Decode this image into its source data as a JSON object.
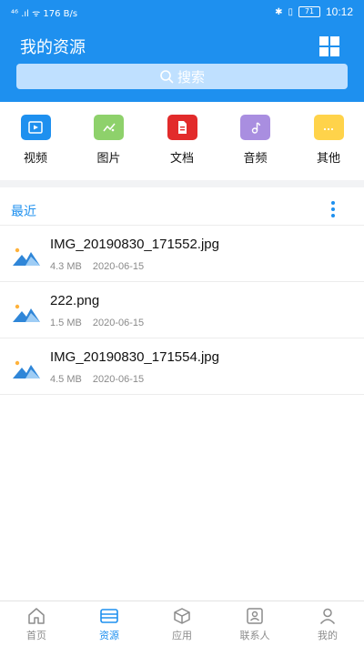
{
  "status_bar": {
    "left_text": "⁴⁶ .ıl ᯤ 176 B/s",
    "battery": "71",
    "time": "10:12"
  },
  "header": {
    "title": "我的资源",
    "search_label": "搜索"
  },
  "categories": [
    {
      "label": "视频",
      "icon": "video-icon",
      "color": "#1e90ef"
    },
    {
      "label": "图片",
      "icon": "image-icon",
      "color": "#8ed16b"
    },
    {
      "label": "文档",
      "icon": "document-icon",
      "color": "#e22b2b"
    },
    {
      "label": "音频",
      "icon": "audio-icon",
      "color": "#a98ee0"
    },
    {
      "label": "其他",
      "icon": "other-icon",
      "color": "#ffd34a"
    }
  ],
  "recent": {
    "title": "最近",
    "files": [
      {
        "name": "IMG_20190830_171552.jpg",
        "size": "4.3 MB",
        "date": "2020-06-15"
      },
      {
        "name": "222.png",
        "size": "1.5 MB",
        "date": "2020-06-15"
      },
      {
        "name": "IMG_20190830_171554.jpg",
        "size": "4.5 MB",
        "date": "2020-06-15"
      }
    ]
  },
  "bottom_nav": [
    {
      "label": "首页",
      "icon": "home-icon",
      "active": false
    },
    {
      "label": "资源",
      "icon": "resource-icon",
      "active": true
    },
    {
      "label": "应用",
      "icon": "app-icon",
      "active": false
    },
    {
      "label": "联系人",
      "icon": "contacts-icon",
      "active": false
    },
    {
      "label": "我的",
      "icon": "profile-icon",
      "active": false
    }
  ],
  "colors": {
    "primary": "#1e90ef",
    "nav_inactive": "#8c8c8c"
  }
}
